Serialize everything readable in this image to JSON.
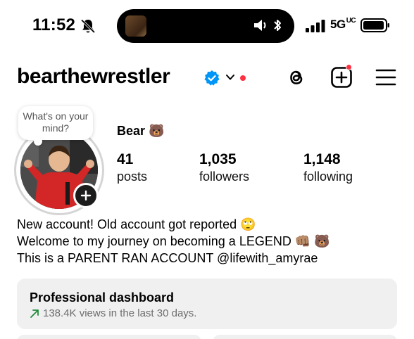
{
  "status_bar": {
    "time": "11:52",
    "network": "5G",
    "network_suffix": "UC"
  },
  "header": {
    "username": "bearthewrestler"
  },
  "profile": {
    "note_text": "What's on your mind?",
    "display_name": "Bear 🐻",
    "stats": [
      {
        "value": "41",
        "label": "posts"
      },
      {
        "value": "1,035",
        "label": "followers"
      },
      {
        "value": "1,148",
        "label": "following"
      }
    ],
    "bio": [
      "New account! Old account got reported 🙄",
      "Welcome to my journey on becoming a LEGEND 👊🏽 🐻",
      "This is a PARENT RAN ACCOUNT @lifewith_amyrae"
    ]
  },
  "dashboard": {
    "title": "Professional dashboard",
    "subtitle": "138.4K views in the last 30 days.",
    "trend_color": "#1f8a3c"
  },
  "colors": {
    "verified": "#0095f6",
    "notification": "#ff3040",
    "card_bg": "#f0f0f0"
  }
}
